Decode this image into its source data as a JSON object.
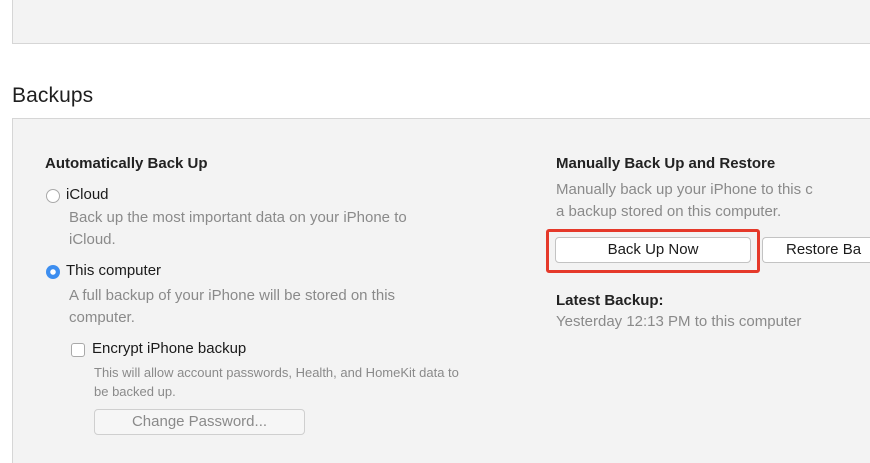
{
  "section": {
    "title": "Backups"
  },
  "auto_backup": {
    "heading": "Automatically Back Up",
    "icloud": {
      "label": "iCloud",
      "description_line1": "Back up the most important data on your iPhone to",
      "description_line2": "iCloud.",
      "selected": false
    },
    "this_computer": {
      "label": "This computer",
      "description_line1": "A full backup of your iPhone will be stored on this",
      "description_line2": "computer.",
      "selected": true
    },
    "encrypt": {
      "label": "Encrypt iPhone backup",
      "checked": false,
      "description_line1": "This will allow account passwords, Health, and HomeKit data to",
      "description_line2": "be backed up."
    },
    "change_password_label": "Change Password..."
  },
  "manual_backup": {
    "heading": "Manually Back Up and Restore",
    "description_line1": "Manually back up your iPhone to this c",
    "description_line2": "a backup stored on this computer.",
    "back_up_now_label": "Back Up Now",
    "restore_label": "Restore Ba"
  },
  "latest_backup": {
    "heading": "Latest Backup:",
    "value": "Yesterday 12:13 PM to this computer"
  },
  "colors": {
    "accent": "#3d8ef0",
    "highlight": "#e5392a",
    "panel": "#f3f3f3"
  }
}
